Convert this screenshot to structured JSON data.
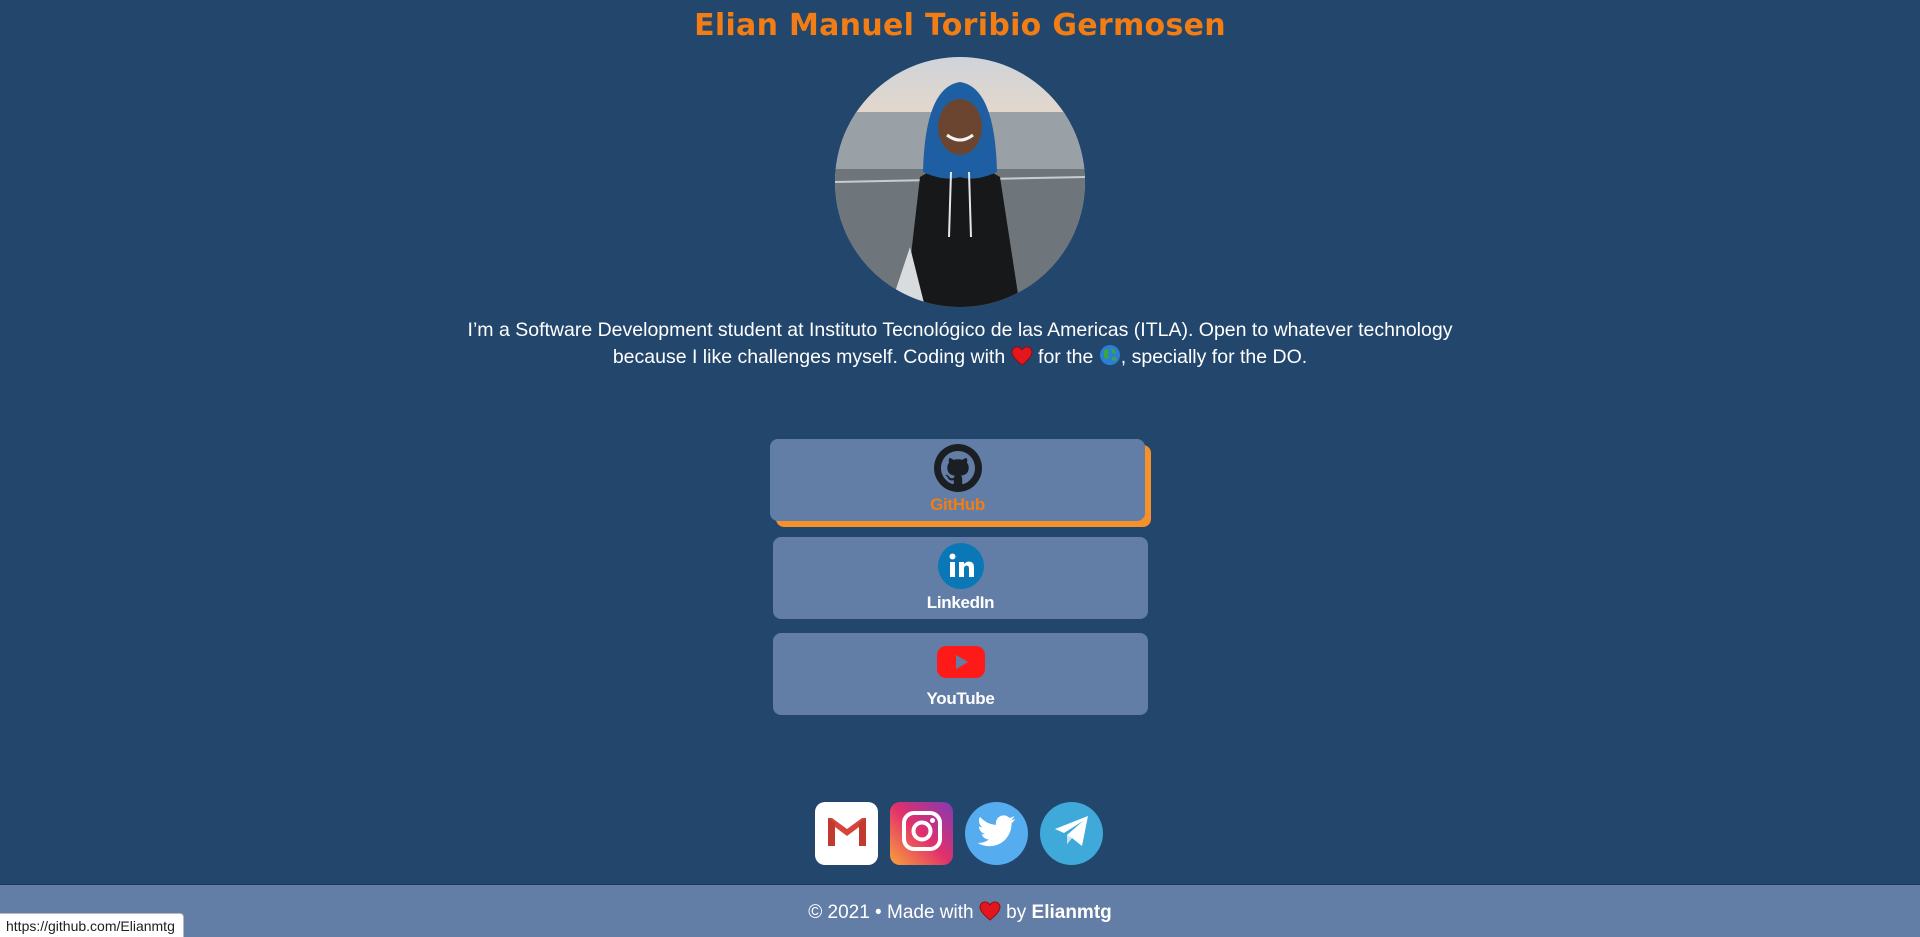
{
  "header": {
    "name": "Elian Manuel Toribio Germosen"
  },
  "bio": {
    "text_1": "I’m a Software Development student at Instituto Tecnológico de las Americas (ITLA). Open to whatever technology because I like challenges myself. Coding with",
    "text_2": "for the",
    "text_3": ", specially for the DO."
  },
  "links": [
    {
      "label": "GitHub",
      "icon": "github-icon"
    },
    {
      "label": "LinkedIn",
      "icon": "linkedin-icon"
    },
    {
      "label": "YouTube",
      "icon": "youtube-icon"
    }
  ],
  "socials": [
    {
      "icon": "gmail-icon"
    },
    {
      "icon": "instagram-icon"
    },
    {
      "icon": "twitter-icon"
    },
    {
      "icon": "telegram-icon"
    }
  ],
  "footer": {
    "prefix": "© 2021 • Made with",
    "by": "by",
    "author": "Elianmtg"
  },
  "status_bar": {
    "url": "https://github.com/Elianmtg"
  },
  "colors": {
    "background": "#23466d",
    "accent": "#f27d14",
    "card": "#637ea6"
  }
}
